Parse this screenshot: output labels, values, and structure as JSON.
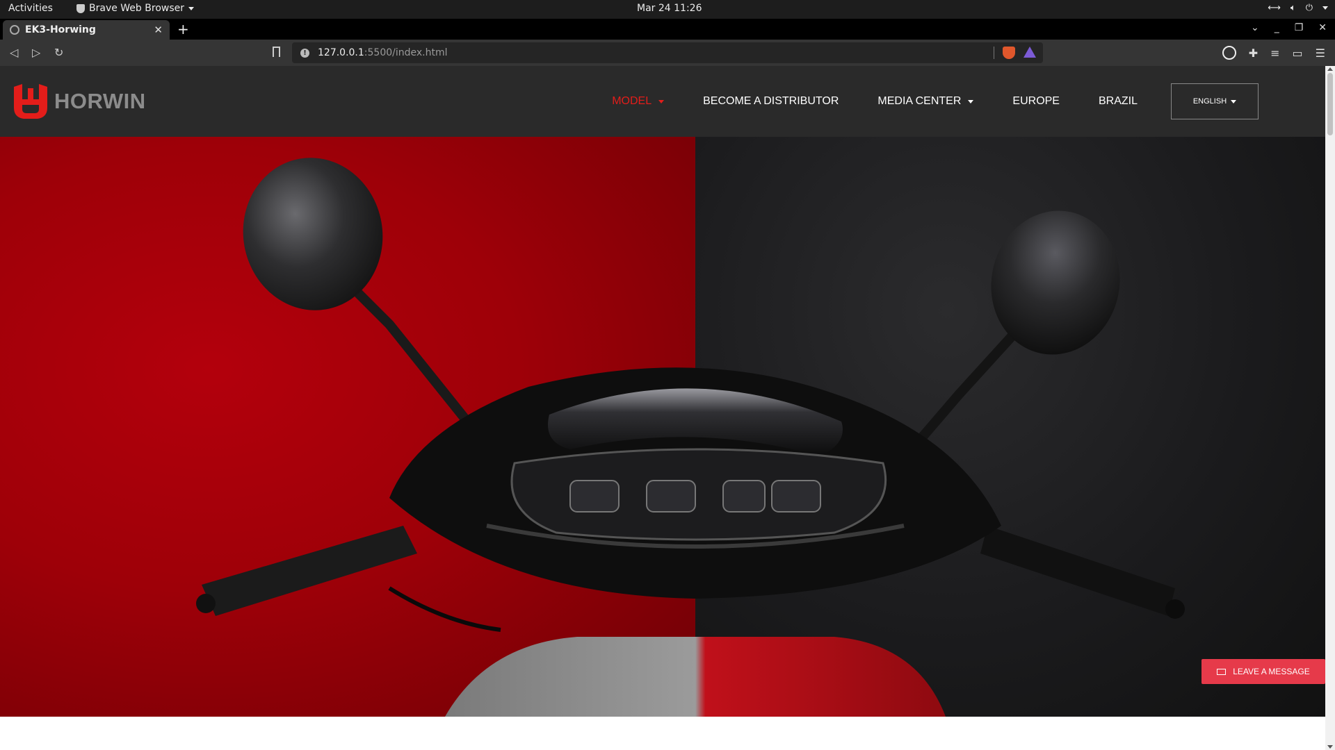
{
  "system_bar": {
    "activities": "Activities",
    "app_name": "Brave Web Browser",
    "clock": "Mar 24  11:26"
  },
  "browser": {
    "tab_title": "EK3-Horwing",
    "url_host": "127.0.0.1",
    "url_rest": ":5500/index.html"
  },
  "site": {
    "logo_text": "HORWIN",
    "nav": [
      {
        "label": "MODEL",
        "dropdown": true,
        "active": true
      },
      {
        "label": "BECOME A DISTRIBUTOR",
        "dropdown": false,
        "active": false
      },
      {
        "label": "MEDIA CENTER",
        "dropdown": true,
        "active": false
      },
      {
        "label": "EUROPE",
        "dropdown": false,
        "active": false
      },
      {
        "label": "BRAZIL",
        "dropdown": false,
        "active": false
      }
    ],
    "language": "ENGLISH",
    "leave_message": "LEAVE A MESSAGE"
  },
  "colors": {
    "brand_red": "#e31d1a",
    "header_bg": "#2a2a2a",
    "message_button": "#e63a4a"
  }
}
